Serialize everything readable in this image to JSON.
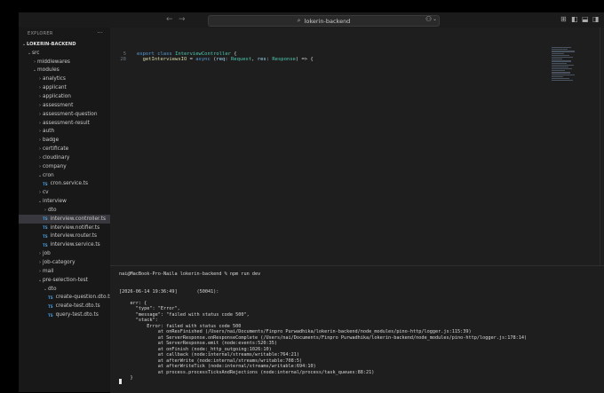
{
  "window": {
    "search_text": "lokerin-backend"
  },
  "icons": {
    "back": "arrow-left-icon",
    "forward": "arrow-right-icon",
    "search": "search-icon",
    "copilot": "copilot-icon",
    "layout": "layout-icon"
  },
  "sidebar": {
    "header": "EXPLORER",
    "more": "···",
    "tree": [
      {
        "label": "LOKERIN-BACKEND",
        "depth": 0,
        "type": "root",
        "expanded": true
      },
      {
        "label": "src",
        "depth": 1,
        "type": "folder",
        "expanded": true
      },
      {
        "label": "middlewares",
        "depth": 2,
        "type": "folder",
        "expanded": false
      },
      {
        "label": "modules",
        "depth": 2,
        "type": "folder",
        "expanded": true
      },
      {
        "label": "analytics",
        "depth": 3,
        "type": "folder",
        "expanded": false
      },
      {
        "label": "applicant",
        "depth": 3,
        "type": "folder",
        "expanded": false
      },
      {
        "label": "application",
        "depth": 3,
        "type": "folder",
        "expanded": false
      },
      {
        "label": "assessment",
        "depth": 3,
        "type": "folder",
        "expanded": false
      },
      {
        "label": "assessment-question",
        "depth": 3,
        "type": "folder",
        "expanded": false
      },
      {
        "label": "assessment-result",
        "depth": 3,
        "type": "folder",
        "expanded": false
      },
      {
        "label": "auth",
        "depth": 3,
        "type": "folder",
        "expanded": false
      },
      {
        "label": "badge",
        "depth": 3,
        "type": "folder",
        "expanded": false
      },
      {
        "label": "certificate",
        "depth": 3,
        "type": "folder",
        "expanded": false
      },
      {
        "label": "cloudinary",
        "depth": 3,
        "type": "folder",
        "expanded": false
      },
      {
        "label": "company",
        "depth": 3,
        "type": "folder",
        "expanded": false
      },
      {
        "label": "cron",
        "depth": 3,
        "type": "folder",
        "expanded": true
      },
      {
        "label": "cron.service.ts",
        "depth": 4,
        "type": "file"
      },
      {
        "label": "cv",
        "depth": 3,
        "type": "folder",
        "expanded": false
      },
      {
        "label": "interview",
        "depth": 3,
        "type": "folder",
        "expanded": true
      },
      {
        "label": "dto",
        "depth": 4,
        "type": "folder",
        "expanded": false
      },
      {
        "label": "interview.controller.ts",
        "depth": 4,
        "type": "file",
        "selected": true
      },
      {
        "label": "interview.notifier.ts",
        "depth": 4,
        "type": "file"
      },
      {
        "label": "interview.router.ts",
        "depth": 4,
        "type": "file"
      },
      {
        "label": "interview.service.ts",
        "depth": 4,
        "type": "file"
      },
      {
        "label": "job",
        "depth": 3,
        "type": "folder",
        "expanded": false
      },
      {
        "label": "job-category",
        "depth": 3,
        "type": "folder",
        "expanded": false
      },
      {
        "label": "mail",
        "depth": 3,
        "type": "folder",
        "expanded": false
      },
      {
        "label": "pre-selection-test",
        "depth": 3,
        "type": "folder",
        "expanded": true
      },
      {
        "label": "dto",
        "depth": 4,
        "type": "folder",
        "expanded": true
      },
      {
        "label": "create-question.dto.ts",
        "depth": 5,
        "type": "file"
      },
      {
        "label": "create-test.dto.ts",
        "depth": 5,
        "type": "file"
      },
      {
        "label": "query-test.dto.ts",
        "depth": 5,
        "type": "file"
      }
    ],
    "file_badge": "TS"
  },
  "editor": {
    "lines": [
      {
        "num": "5",
        "tokens": [
          [
            "kw",
            "export "
          ],
          [
            "kw",
            "class "
          ],
          [
            "cls",
            "InterviewController"
          ],
          [
            "pn",
            " {"
          ]
        ]
      },
      {
        "num": "28",
        "tokens": [
          [
            "pn",
            "  "
          ],
          [
            "fn",
            "getInterviewsIO"
          ],
          [
            "pn",
            " = "
          ],
          [
            "kw",
            "async "
          ],
          [
            "pn",
            "("
          ],
          [
            "prm",
            "req"
          ],
          [
            "pn",
            ": "
          ],
          [
            "cls",
            "Request"
          ],
          [
            "pn",
            ", "
          ],
          [
            "prm",
            "res"
          ],
          [
            "pn",
            ": "
          ],
          [
            "cls",
            "Response"
          ],
          [
            "pn",
            ") => {"
          ]
        ]
      }
    ]
  },
  "terminal": {
    "lines": [
      "nai@MacBook-Pro-Naila lokerin-backend % npm run dev",
      "",
      "",
      "[2026-06-14 19:36:49]       (50041):",
      "",
      "    err: {",
      "      \"type\": \"Error\",",
      "      \"message\": \"failed with status code 500\",",
      "      \"stack\":",
      "          Error: failed with status code 500",
      "              at onResFinished (/Users/nai/Documents/Finpro Purwadhika/lokerin-backend/node_modules/pino-http/logger.js:115:39)",
      "              at ServerResponse.onResponseComplete (/Users/nai/Documents/Finpro Purwadhika/lokerin-backend/node_modules/pino-http/logger.js:178:14)",
      "              at ServerResponse.emit (node:events:520:35)",
      "              at onFinish (node:_http_outgoing:1026:10)",
      "              at callback (node:internal/streams/writable:764:21)",
      "              at afterWrite (node:internal/streams/writable:708:5)",
      "              at afterWriteTick (node:internal/streams/writable:694:10)",
      "              at process.processTicksAndRejections (node:internal/process/task_queues:88:21)",
      "    }"
    ]
  }
}
